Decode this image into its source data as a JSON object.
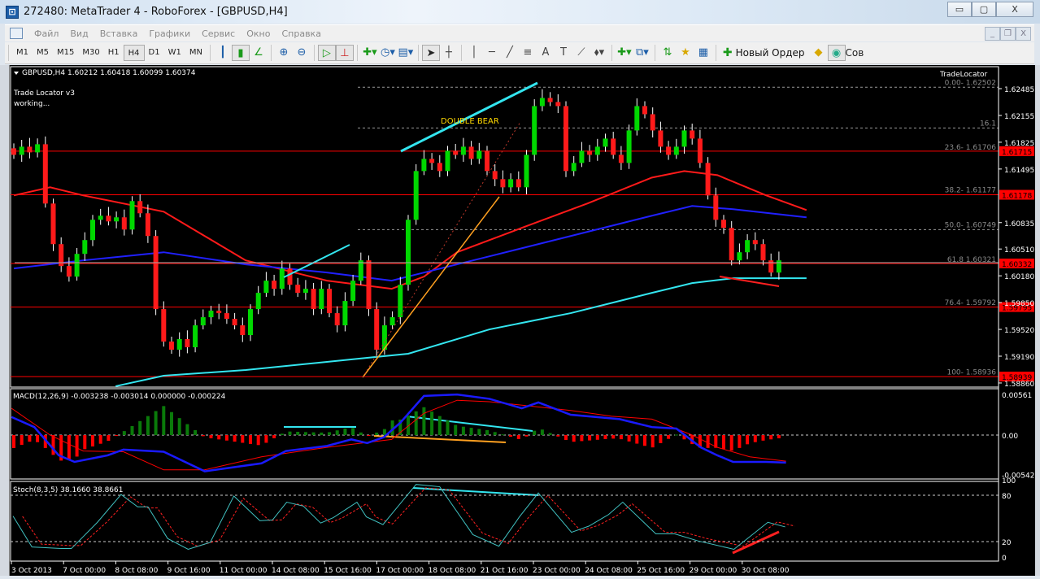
{
  "window": {
    "title": "272480: MetaTrader 4 - RoboForex - [GBPUSD,H4]",
    "minimize": "▭",
    "maximize": "▢",
    "close": "X"
  },
  "menu": [
    "Файл",
    "Вид",
    "Вставка",
    "Графики",
    "Сервис",
    "Окно",
    "Справка"
  ],
  "mdi": [
    "_",
    "❐",
    "X"
  ],
  "toolbar": {
    "timeframes": [
      "M1",
      "M5",
      "M15",
      "M30",
      "H1",
      "H4",
      "D1",
      "W1",
      "MN"
    ],
    "selected_tf": "H4",
    "new_order": "Новый Ордер",
    "cut_label": "Сов"
  },
  "chart": {
    "header": "GBPUSD,H4  1.60212 1.60418 1.60099 1.60374",
    "indicator_name": "Trade Locator  v3",
    "indicator_status": " working...",
    "trade_locator_label": "TradeLocator",
    "pattern_label": "DOUBLE BEAR",
    "price_axis": [
      "1.62485",
      "1.62155",
      "1.61825",
      "1.61495",
      "1.60835",
      "1.60510",
      "1.60180",
      "1.59850",
      "1.59520",
      "1.59190",
      "1.58860"
    ],
    "hlines": [
      {
        "price": 1.61715,
        "label": "1.61715"
      },
      {
        "price": 1.61178,
        "label": "1.61178"
      },
      {
        "price": 1.60332,
        "label": "1.60332"
      },
      {
        "price": 1.59795,
        "label": "1.59795"
      },
      {
        "price": 1.58939,
        "label": "1.58939"
      }
    ],
    "fib": [
      {
        "price": 1.62502,
        "label": "0.00- 1.62502",
        "dashed": true
      },
      {
        "price": 1.62,
        "label": "16.1",
        "dashed": true
      },
      {
        "price": 1.61706,
        "label": "23.6- 1.61706",
        "dashed": false
      },
      {
        "price": 1.61177,
        "label": "38.2- 1.61177",
        "dashed": false
      },
      {
        "price": 1.60749,
        "label": "50.0- 1.60749",
        "dashed": true
      },
      {
        "price": 1.60321,
        "label": "61.8 1.60321",
        "dashed": false
      },
      {
        "price": 1.59792,
        "label": "76.4- 1.59792",
        "dashed": false
      },
      {
        "price": 1.58936,
        "label": "100- 1.58936",
        "dashed": false
      }
    ],
    "closes": [
      1.6167,
      1.6177,
      1.617,
      1.618,
      1.6107,
      1.6057,
      1.603,
      1.6017,
      1.6045,
      1.6062,
      1.6087,
      1.6092,
      1.6085,
      1.609,
      1.6075,
      1.611,
      1.6095,
      1.6067,
      1.5977,
      1.5937,
      1.5927,
      1.594,
      1.593,
      1.5957,
      1.5967,
      1.5975,
      1.5972,
      1.5965,
      1.5957,
      1.5945,
      1.5977,
      1.5997,
      1.6012,
      1.6002,
      1.6027,
      1.6007,
      1.5997,
      1.6002,
      1.5977,
      1.6002,
      1.5972,
      1.5957,
      1.5987,
      1.6012,
      1.6037,
      1.5977,
      1.5927,
      1.5957,
      1.5967,
      1.6007,
      1.6087,
      1.6147,
      1.6162,
      1.6157,
      1.6147,
      1.6172,
      1.6167,
      1.6177,
      1.6162,
      1.6172,
      1.6147,
      1.6137,
      1.6127,
      1.6137,
      1.6127,
      1.6167,
      1.6227,
      1.6237,
      1.6232,
      1.6227,
      1.6147,
      1.6157,
      1.6172,
      1.6167,
      1.6177,
      1.6187,
      1.6167,
      1.6157,
      1.6197,
      1.6227,
      1.6217,
      1.6197,
      1.6177,
      1.6167,
      1.6177,
      1.6197,
      1.6187,
      1.6157,
      1.6117,
      1.6087,
      1.6077,
      1.6037,
      1.6047,
      1.6062,
      1.6057,
      1.6037,
      1.6022,
      1.6037
    ],
    "ma_red": [
      [
        0,
        1.6117
      ],
      [
        4.6,
        1.6127
      ],
      [
        8.8,
        1.6117
      ],
      [
        19,
        1.6097
      ],
      [
        29.4,
        1.6037
      ],
      [
        39.7,
        1.6012
      ],
      [
        47.9,
        1.6002
      ],
      [
        52,
        1.6017
      ],
      [
        56.2,
        1.6047
      ],
      [
        64.4,
        1.6077
      ],
      [
        72.7,
        1.6107
      ],
      [
        80.9,
        1.6139
      ],
      [
        85,
        1.6147
      ],
      [
        89.2,
        1.6142
      ],
      [
        95.4,
        1.6117
      ],
      [
        100.5,
        1.6099
      ]
    ],
    "ma_blue": [
      [
        0,
        1.6027
      ],
      [
        8.8,
        1.6037
      ],
      [
        19,
        1.6047
      ],
      [
        29.4,
        1.6032
      ],
      [
        39.7,
        1.6022
      ],
      [
        47.9,
        1.6012
      ],
      [
        52,
        1.6022
      ],
      [
        60.3,
        1.6042
      ],
      [
        70.6,
        1.6067
      ],
      [
        80.9,
        1.6092
      ],
      [
        86,
        1.6104
      ],
      [
        91.2,
        1.61
      ],
      [
        100.5,
        1.609
      ]
    ],
    "ma_cyan": [
      [
        12.9,
        1.5882
      ],
      [
        19,
        1.5895
      ],
      [
        29.4,
        1.5902
      ],
      [
        39.7,
        1.5912
      ],
      [
        44.8,
        1.5917
      ],
      [
        50,
        1.5922
      ],
      [
        60.3,
        1.5952
      ],
      [
        70.6,
        1.5972
      ],
      [
        80.9,
        1.5997
      ],
      [
        86,
        1.6009
      ],
      [
        91.2,
        1.6015
      ],
      [
        100.5,
        1.6015
      ]
    ]
  },
  "macd": {
    "label": "MACD(12,26,9) -0.003238 -0.003014 0.000000 -0.000224",
    "axis": [
      "0.00561",
      "0.00",
      "-0.005428"
    ],
    "max": 0.00561,
    "min": -0.005428,
    "main": [
      [
        -0.3,
        0.0025
      ],
      [
        2.6,
        0.0011
      ],
      [
        5.7,
        -0.0028
      ],
      [
        7.7,
        -0.0037
      ],
      [
        11.9,
        -0.0028
      ],
      [
        13.9,
        -0.002
      ],
      [
        19,
        -0.0023
      ],
      [
        24.2,
        -0.005
      ],
      [
        31.4,
        -0.0039
      ],
      [
        34.5,
        -0.0022
      ],
      [
        39.7,
        -0.0015
      ],
      [
        42.8,
        -0.0006
      ],
      [
        44.8,
        -0.0011
      ],
      [
        46.9,
        -0.0003
      ],
      [
        49,
        0.0017
      ],
      [
        52,
        0.0054
      ],
      [
        56.2,
        0.0056
      ],
      [
        60.3,
        0.005
      ],
      [
        64.4,
        0.0037
      ],
      [
        66.5,
        0.0045
      ],
      [
        70.6,
        0.0028
      ],
      [
        76.8,
        0.0022
      ],
      [
        80.9,
        0.0011
      ],
      [
        84,
        0.0009
      ],
      [
        87.1,
        -0.0017
      ],
      [
        89.2,
        -0.0028
      ],
      [
        91.2,
        -0.0037
      ],
      [
        95.4,
        -0.0037
      ],
      [
        97.9,
        -0.0038
      ]
    ],
    "signal": [
      [
        -0.3,
        0.0037
      ],
      [
        4.6,
        0
      ],
      [
        8.8,
        -0.0022
      ],
      [
        13.9,
        -0.0023
      ],
      [
        19,
        -0.0048
      ],
      [
        24.2,
        -0.0048
      ],
      [
        31.4,
        -0.003
      ],
      [
        39.7,
        -0.0017
      ],
      [
        47.9,
        -0.0006
      ],
      [
        52,
        0.003
      ],
      [
        56.2,
        0.0048
      ],
      [
        60.3,
        0.0046
      ],
      [
        70.6,
        0.0034
      ],
      [
        75.8,
        0.0026
      ],
      [
        80.9,
        0.0022
      ],
      [
        86,
        0
      ],
      [
        89.2,
        -0.0017
      ],
      [
        93.3,
        -0.003
      ],
      [
        97.9,
        -0.0036
      ]
    ]
  },
  "stoch": {
    "label": "Stoch(8,3,5) 38.1660 38.8661",
    "axis": [
      "100",
      "80",
      "20",
      "0"
    ],
    "main": [
      [
        -0.1,
        53
      ],
      [
        2.3,
        13
      ],
      [
        6,
        11
      ],
      [
        7.3,
        11
      ],
      [
        10.6,
        45
      ],
      [
        13.6,
        81
      ],
      [
        15.7,
        65
      ],
      [
        17,
        65
      ],
      [
        19.5,
        24
      ],
      [
        22.1,
        10
      ],
      [
        24.9,
        19
      ],
      [
        27.9,
        79
      ],
      [
        31.2,
        47
      ],
      [
        32.8,
        48
      ],
      [
        34.6,
        71
      ],
      [
        36.7,
        66
      ],
      [
        38.9,
        44
      ],
      [
        40.5,
        51
      ],
      [
        43.5,
        71
      ],
      [
        44.7,
        52
      ],
      [
        46.8,
        42
      ],
      [
        51,
        94
      ],
      [
        54,
        91
      ],
      [
        58.2,
        29
      ],
      [
        61.5,
        14
      ],
      [
        64.1,
        52
      ],
      [
        66.5,
        83
      ],
      [
        70.7,
        32
      ],
      [
        72.9,
        40
      ],
      [
        75.4,
        55
      ],
      [
        77.2,
        71
      ],
      [
        81.4,
        30
      ],
      [
        83.8,
        30
      ],
      [
        86.7,
        21
      ],
      [
        91.3,
        10
      ],
      [
        95.6,
        45
      ],
      [
        97.8,
        39
      ]
    ]
  },
  "time_axis": [
    "3 Oct 2013",
    "7 Oct 00:00",
    "8 Oct 08:00",
    "9 Oct 16:00",
    "11 Oct 00:00",
    "14 Oct 08:00",
    "15 Oct 16:00",
    "17 Oct 00:00",
    "18 Oct 08:00",
    "21 Oct 16:00",
    "23 Oct 00:00",
    "24 Oct 08:00",
    "25 Oct 16:00",
    "29 Oct 00:00",
    "30 Oct 08:00"
  ],
  "colors": {
    "bull": "#00d800",
    "bear": "#ff1a1a",
    "ma_red": "#ff1a1a",
    "ma_blue": "#2020ff",
    "ma_cyan": "#33e6f0",
    "hline": "#ff0000",
    "fib": "#8a8a8a",
    "macd_main": "#1a1aff",
    "macd_signal": "#ff0000",
    "hist_pos": "#0a7a0a",
    "hist_neg": "#ff0000",
    "stoch_main": "#40c0c0",
    "stoch_signal": "#ff2020"
  }
}
